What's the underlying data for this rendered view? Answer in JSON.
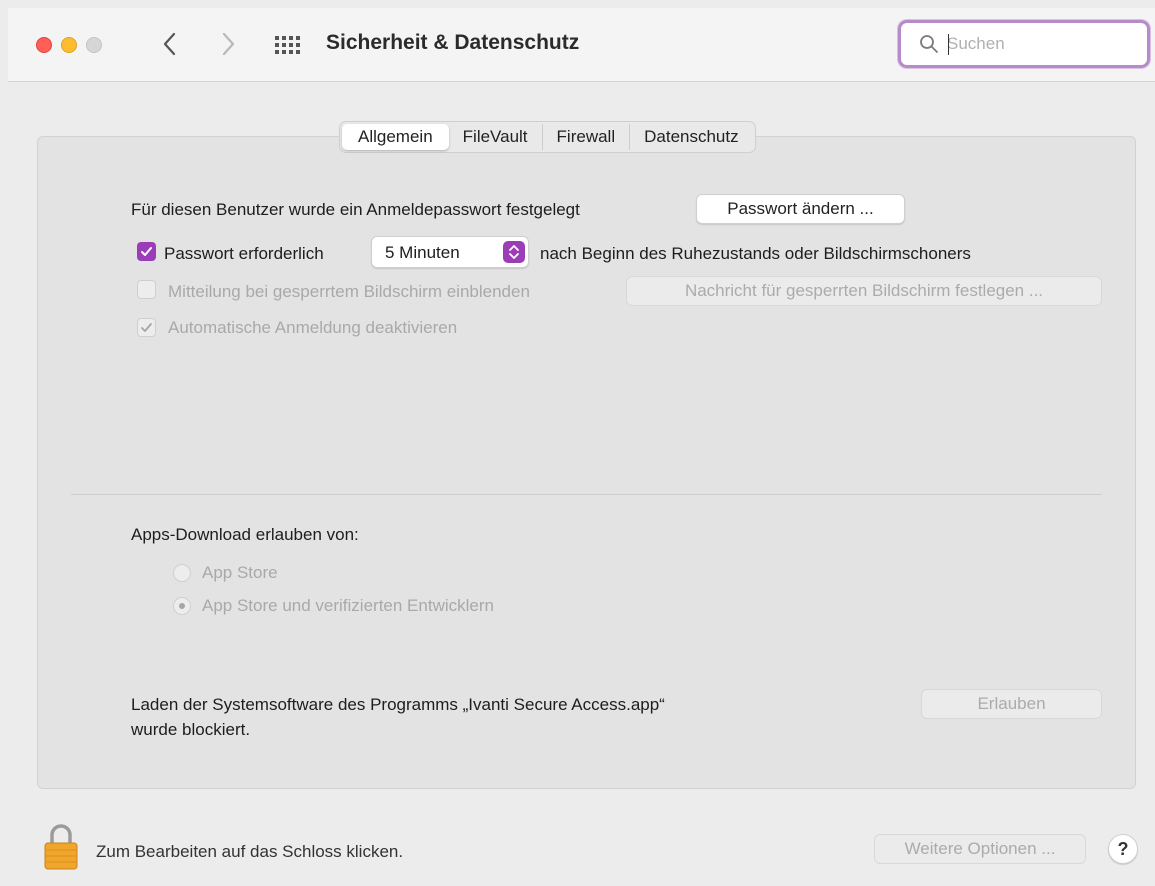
{
  "window": {
    "title": "Sicherheit & Datenschutz"
  },
  "search": {
    "placeholder": "Suchen",
    "value": ""
  },
  "tabs": [
    {
      "label": "Allgemein",
      "active": true
    },
    {
      "label": "FileVault",
      "active": false
    },
    {
      "label": "Firewall",
      "active": false
    },
    {
      "label": "Datenschutz",
      "active": false
    }
  ],
  "general": {
    "password_set_text": "Für diesen Benutzer wurde ein Anmeldepasswort festgelegt",
    "change_password_label": "Passwort ändern ...",
    "require_password_label": "Passwort erforderlich",
    "require_password_checked": true,
    "require_password_delay": "5 Minuten",
    "require_password_suffix": "nach Beginn des Ruhezustands oder Bildschirmschoners",
    "lock_message_label": "Mitteilung bei gesperrtem Bildschirm einblenden",
    "lock_message_checked": false,
    "lock_message_button": "Nachricht für gesperrten Bildschirm festlegen ...",
    "auto_login_label": "Automatische Anmeldung deaktivieren",
    "auto_login_checked": true
  },
  "downloads": {
    "heading": "Apps-Download erlauben von:",
    "options": [
      {
        "label": "App Store",
        "selected": false
      },
      {
        "label": "App Store und verifizierten Entwicklern",
        "selected": true
      }
    ]
  },
  "blocked": {
    "line1": "Laden der Systemsoftware des Programms „Ivanti Secure Access.app“",
    "line2": "wurde blockiert.",
    "allow_label": "Erlauben"
  },
  "footer": {
    "lock_text": "Zum Bearbeiten auf das Schloss klicken.",
    "more_options_label": "Weitere Optionen ...",
    "help_label": "?"
  },
  "colors": {
    "accent": "#9c3db8",
    "focus_ring": "#b58bc9",
    "close": "#ff5f57",
    "minimize": "#febc2e"
  }
}
